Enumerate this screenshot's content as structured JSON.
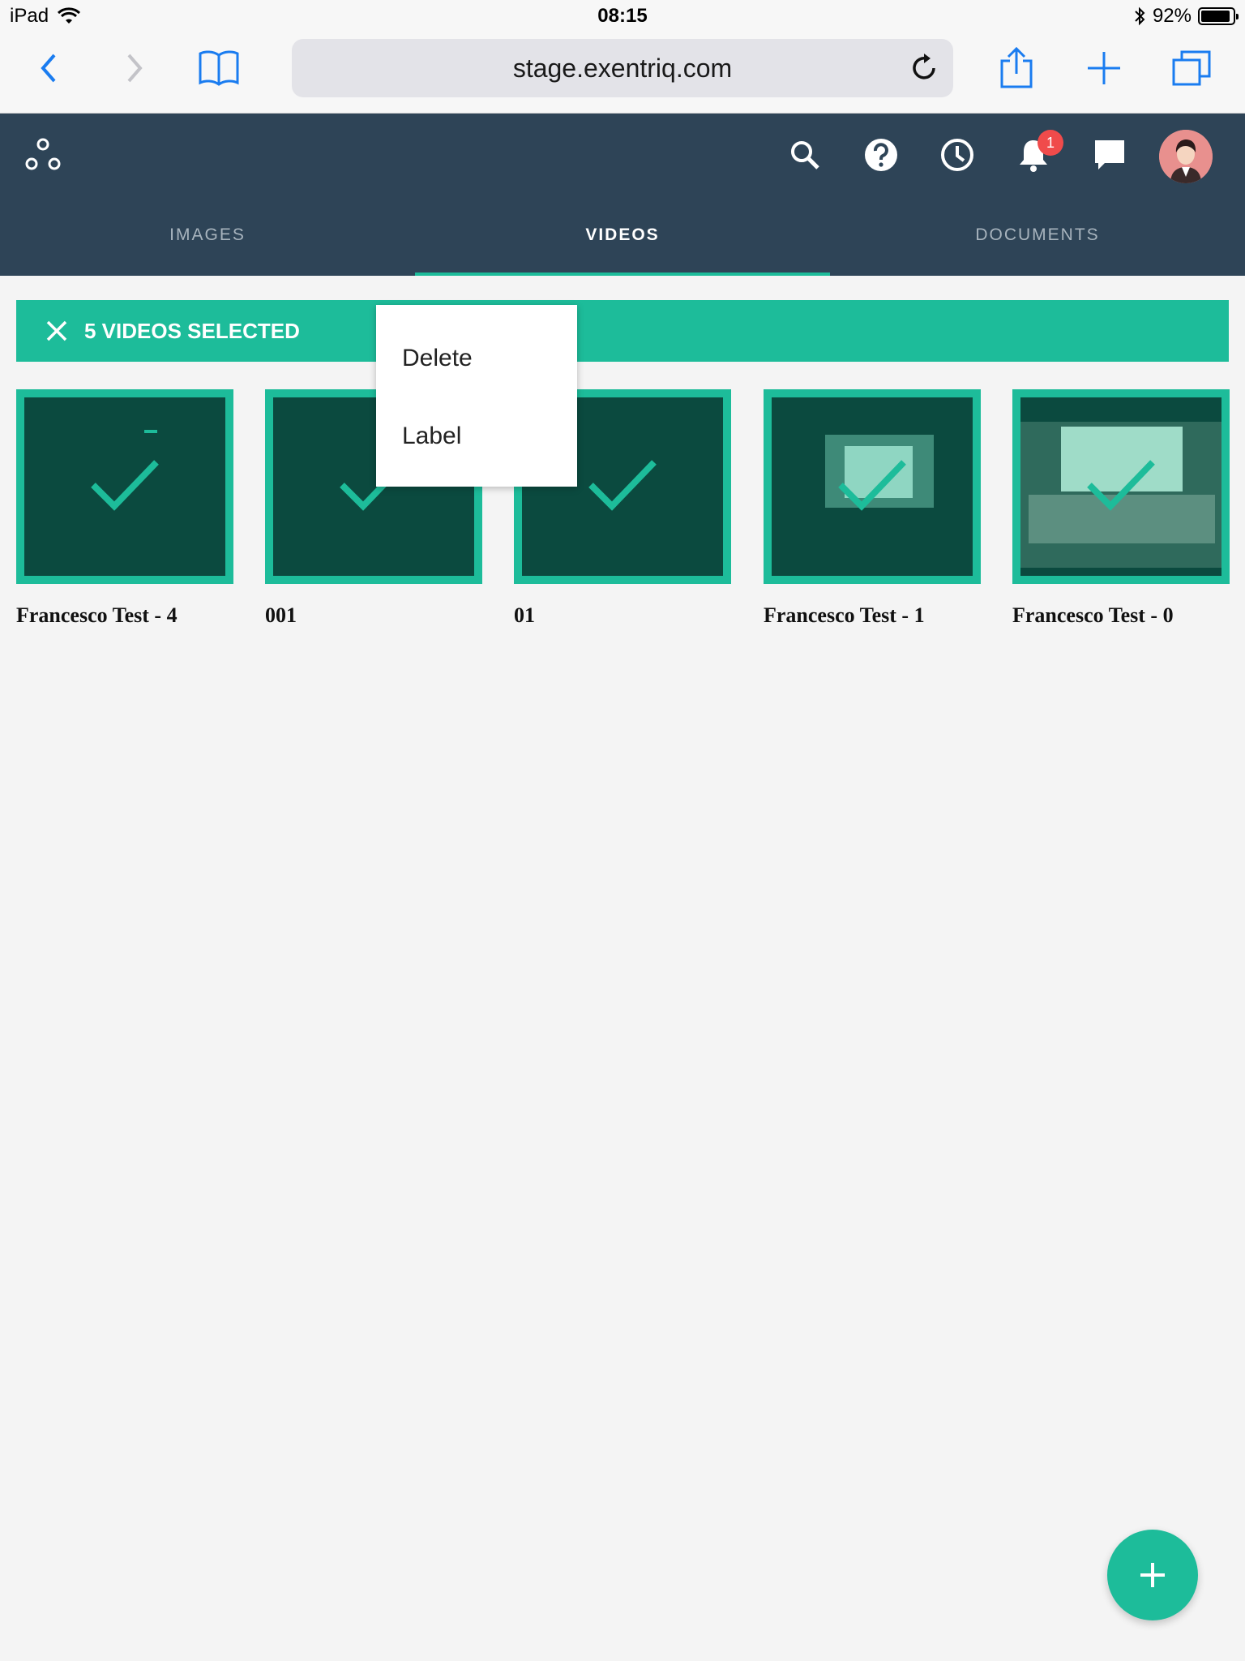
{
  "status_bar": {
    "device": "iPad",
    "time": "08:15",
    "battery_percent": "92%",
    "battery_level": 0.92
  },
  "browser": {
    "url": "stage.exentriq.com",
    "icons": [
      "back-icon",
      "forward-icon",
      "bookmarks-icon",
      "reload-icon",
      "share-icon",
      "new-tab-icon",
      "tabs-icon"
    ]
  },
  "header": {
    "icons": [
      "app-logo-icon",
      "search-icon",
      "help-icon",
      "history-icon",
      "bell-icon",
      "chat-icon"
    ],
    "notification_count": "1"
  },
  "tabs": [
    {
      "label": "IMAGES",
      "active": false
    },
    {
      "label": "VIDEOS",
      "active": true
    },
    {
      "label": "DOCUMENTS",
      "active": false
    }
  ],
  "selection": {
    "label": "5 VIDEOS SELECTED"
  },
  "menu": {
    "items": [
      "Delete",
      "Label"
    ]
  },
  "videos": [
    {
      "title": "Francesco Test - 4"
    },
    {
      "title": "001"
    },
    {
      "title": "01"
    },
    {
      "title": "Francesco Test - 1"
    },
    {
      "title": "Francesco Test - 0"
    }
  ],
  "colors": {
    "accent": "#1dbc9a",
    "header_bg": "#2e4457",
    "badge": "#f04b4b",
    "ios_blue": "#1a7cf0"
  }
}
